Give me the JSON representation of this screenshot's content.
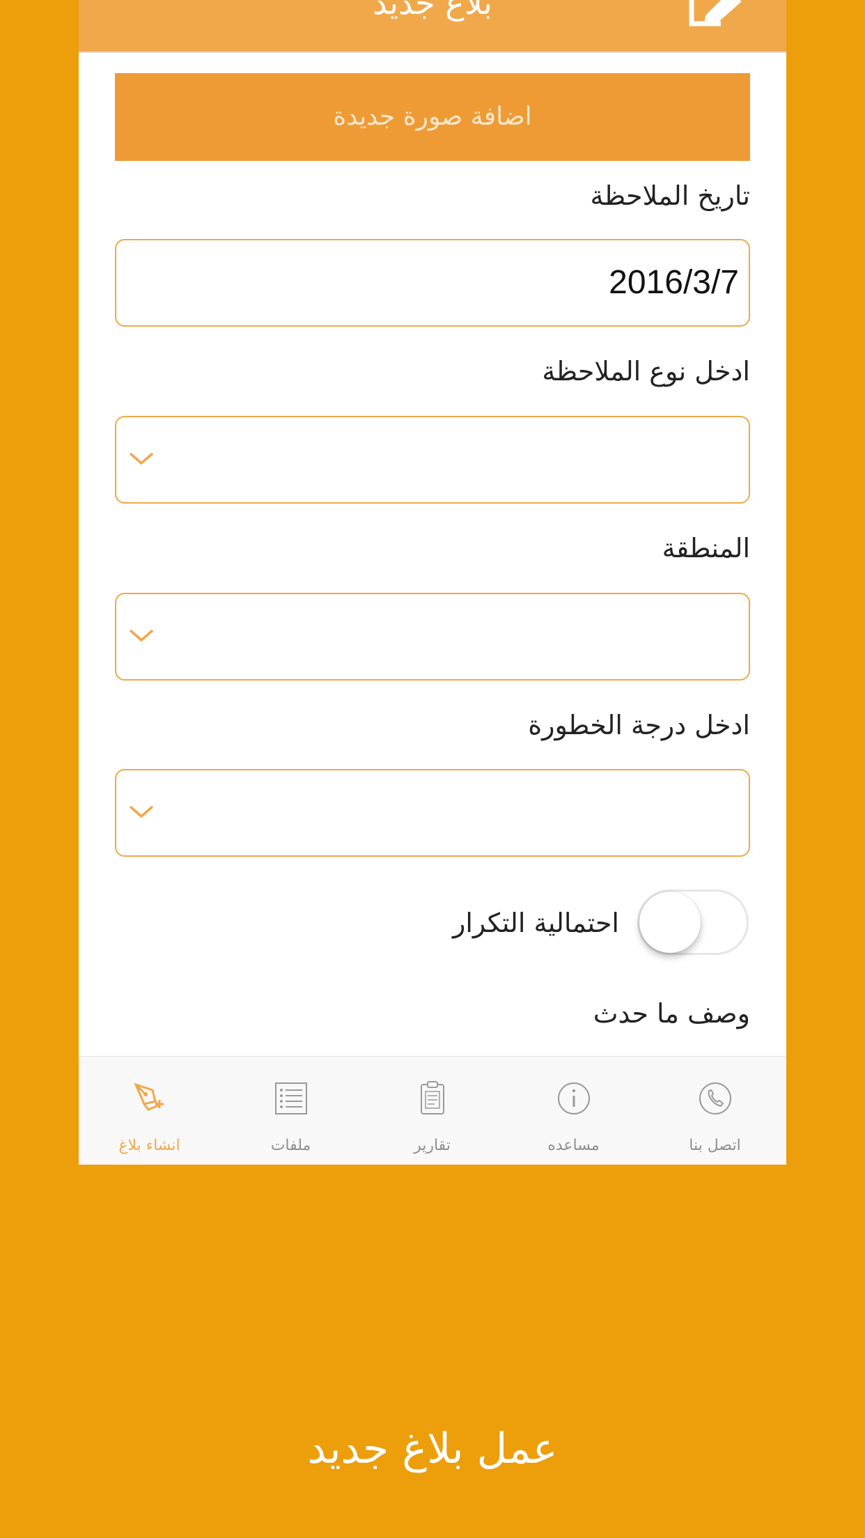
{
  "header": {
    "title": "بلاغ جديد",
    "action_icon": "edit-icon"
  },
  "form": {
    "add_photo_label": "اضافة صورة جديدة",
    "date_label": "تاريخ الملاحظة",
    "date_value": "2016/3/7",
    "type_label": "ادخل نوع الملاحظة",
    "type_value": "",
    "region_label": "المنطقة",
    "region_value": "",
    "severity_label": "ادخل درجة الخطورة",
    "severity_value": "",
    "recurrence_label": "احتمالية التكرار",
    "recurrence_on": false,
    "description_label": "وصف ما حدث"
  },
  "tabbar": {
    "items": [
      {
        "label": "انشاء بلاغ",
        "icon": "new-report-icon",
        "active": true
      },
      {
        "label": "ملفات",
        "icon": "list-icon",
        "active": false
      },
      {
        "label": "تقارير",
        "icon": "clipboard-icon",
        "active": false
      },
      {
        "label": "مساعده",
        "icon": "info-icon",
        "active": false
      },
      {
        "label": "اتصل بنا",
        "icon": "phone-icon",
        "active": false
      }
    ]
  },
  "caption": "عمل بلاغ جديد",
  "colors": {
    "background": "#EC9E0B",
    "accent": "#F0A84B",
    "button": "#EE9B35"
  }
}
